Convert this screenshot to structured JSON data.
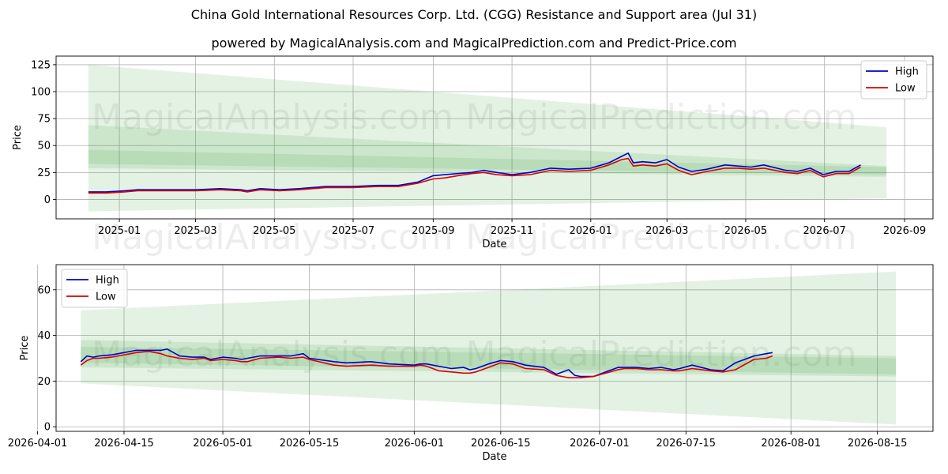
{
  "title": "China Gold International Resources Corp. Ltd. (CGG) Resistance and Support area (Jul 31)",
  "subtitle": "powered by MagicalAnalysis.com and MagicalPrediction.com and Predict-Price.com",
  "watermarks": [
    "MagicalAnalysis.com",
    "MagicalPrediction.com"
  ],
  "colors": {
    "high": "#0000cc",
    "low": "#dd0000",
    "band": "#2e9a2e"
  },
  "chart_data": [
    {
      "type": "line",
      "xlabel": "Date",
      "ylabel": "Price",
      "xlim": [
        "2024-11-13",
        "2026-09-23"
      ],
      "ylim": [
        -18,
        133
      ],
      "x_ticks": [
        "2025-01",
        "2025-03",
        "2025-05",
        "2025-07",
        "2025-09",
        "2025-11",
        "2026-01",
        "2026-03",
        "2026-05",
        "2026-07",
        "2026-09"
      ],
      "y_ticks": [
        0,
        25,
        50,
        75,
        100,
        125
      ],
      "grid": true,
      "legend": "top-right",
      "bands": [
        {
          "x": [
            "2024-12-08",
            "2026-08-18"
          ],
          "upper": [
            125,
            67
          ],
          "lower": [
            -11,
            1
          ]
        },
        {
          "x": [
            "2024-12-08",
            "2026-08-18"
          ],
          "upper": [
            69,
            31
          ],
          "lower": [
            29,
            21
          ]
        },
        {
          "x": [
            "2024-12-08",
            "2026-08-18"
          ],
          "upper": [
            46,
            30
          ],
          "lower": [
            33,
            23
          ]
        }
      ],
      "series": [
        {
          "name": "High",
          "x": [
            "2024-12-08",
            "2024-12-22",
            "2025-01-05",
            "2025-01-15",
            "2025-02-01",
            "2025-02-15",
            "2025-03-01",
            "2025-03-20",
            "2025-04-05",
            "2025-04-10",
            "2025-04-20",
            "2025-05-05",
            "2025-05-20",
            "2025-06-10",
            "2025-07-01",
            "2025-07-20",
            "2025-08-05",
            "2025-08-20",
            "2025-09-01",
            "2025-09-10",
            "2025-09-20",
            "2025-10-01",
            "2025-10-10",
            "2025-10-20",
            "2025-11-01",
            "2025-11-15",
            "2025-12-01",
            "2025-12-15",
            "2026-01-01",
            "2026-01-15",
            "2026-01-25",
            "2026-01-30",
            "2026-02-03",
            "2026-02-10",
            "2026-02-20",
            "2026-03-01",
            "2026-03-10",
            "2026-03-20",
            "2026-04-01",
            "2026-04-15",
            "2026-04-25",
            "2026-05-05",
            "2026-05-15",
            "2026-06-01",
            "2026-06-10",
            "2026-06-20",
            "2026-06-30",
            "2026-07-10",
            "2026-07-20",
            "2026-07-29"
          ],
          "values": [
            7,
            7,
            8,
            9,
            9,
            9,
            9,
            10,
            9,
            8,
            10,
            9,
            10,
            12,
            12,
            13,
            13,
            16,
            22,
            23,
            24,
            25,
            27,
            25,
            23,
            25,
            29,
            28,
            29,
            34,
            40,
            43,
            34,
            35,
            34,
            37,
            30,
            26,
            28,
            32,
            31,
            30,
            32,
            27,
            26,
            29,
            23,
            26,
            26,
            32
          ]
        },
        {
          "name": "Low",
          "x": [
            "2024-12-08",
            "2024-12-22",
            "2025-01-05",
            "2025-01-15",
            "2025-02-01",
            "2025-02-15",
            "2025-03-01",
            "2025-03-20",
            "2025-04-05",
            "2025-04-10",
            "2025-04-20",
            "2025-05-05",
            "2025-05-20",
            "2025-06-10",
            "2025-07-01",
            "2025-07-20",
            "2025-08-05",
            "2025-08-20",
            "2025-09-01",
            "2025-09-10",
            "2025-09-20",
            "2025-10-01",
            "2025-10-10",
            "2025-10-20",
            "2025-11-01",
            "2025-11-15",
            "2025-12-01",
            "2025-12-15",
            "2026-01-01",
            "2026-01-15",
            "2026-01-25",
            "2026-01-30",
            "2026-02-03",
            "2026-02-10",
            "2026-02-20",
            "2026-03-01",
            "2026-03-10",
            "2026-03-20",
            "2026-04-01",
            "2026-04-15",
            "2026-04-25",
            "2026-05-05",
            "2026-05-15",
            "2026-06-01",
            "2026-06-10",
            "2026-06-20",
            "2026-06-30",
            "2026-07-10",
            "2026-07-20",
            "2026-07-29"
          ],
          "values": [
            6,
            6,
            7,
            8,
            8,
            8,
            8,
            9,
            8,
            7,
            9,
            8,
            9,
            11,
            11,
            12,
            12,
            15,
            19,
            20,
            22,
            24,
            25,
            23,
            22,
            23,
            27,
            26,
            27,
            32,
            37,
            38,
            31,
            32,
            31,
            33,
            27,
            23,
            26,
            29,
            29,
            28,
            29,
            25,
            24,
            27,
            21,
            24,
            24,
            30
          ]
        }
      ]
    },
    {
      "type": "line",
      "xlabel": "Date",
      "ylabel": "Price",
      "xlim": [
        "2026-04-04",
        "2026-08-24"
      ],
      "ylim": [
        -2,
        71
      ],
      "x_ticks": [
        "2026-04-01",
        "2026-04-15",
        "2026-05-01",
        "2026-05-15",
        "2026-06-01",
        "2026-06-15",
        "2026-07-01",
        "2026-07-15",
        "2026-08-01",
        "2026-08-15"
      ],
      "y_ticks": [
        0,
        20,
        40,
        60
      ],
      "grid": true,
      "legend": "top-left",
      "bands": [
        {
          "x": [
            "2026-04-08",
            "2026-08-18"
          ],
          "upper": [
            51,
            68
          ],
          "lower": [
            19,
            1
          ]
        },
        {
          "x": [
            "2026-04-08",
            "2026-08-18"
          ],
          "upper": [
            38,
            31
          ],
          "lower": [
            26,
            22
          ]
        },
        {
          "x": [
            "2026-04-08",
            "2026-08-18"
          ],
          "upper": [
            35,
            30
          ],
          "lower": [
            28,
            23
          ]
        }
      ],
      "series": [
        {
          "name": "High",
          "x": [
            "2026-04-08",
            "2026-04-09",
            "2026-04-10",
            "2026-04-11",
            "2026-04-13",
            "2026-04-15",
            "2026-04-17",
            "2026-04-19",
            "2026-04-21",
            "2026-04-22",
            "2026-04-24",
            "2026-04-26",
            "2026-04-28",
            "2026-04-29",
            "2026-05-01",
            "2026-05-03",
            "2026-05-04",
            "2026-05-05",
            "2026-05-07",
            "2026-05-10",
            "2026-05-12",
            "2026-05-14",
            "2026-05-15",
            "2026-05-19",
            "2026-05-21",
            "2026-05-25",
            "2026-05-28",
            "2026-06-01",
            "2026-06-02",
            "2026-06-03",
            "2026-06-05",
            "2026-06-07",
            "2026-06-09",
            "2026-06-10",
            "2026-06-11",
            "2026-06-13",
            "2026-06-15",
            "2026-06-17",
            "2026-06-19",
            "2026-06-22",
            "2026-06-24",
            "2026-06-26",
            "2026-06-27",
            "2026-06-28",
            "2026-06-30",
            "2026-07-02",
            "2026-07-04",
            "2026-07-05",
            "2026-07-07",
            "2026-07-09",
            "2026-07-11",
            "2026-07-13",
            "2026-07-14",
            "2026-07-16",
            "2026-07-19",
            "2026-07-21",
            "2026-07-23",
            "2026-07-26",
            "2026-07-28",
            "2026-07-29"
          ],
          "values": [
            28.5,
            31,
            30.5,
            31,
            31.5,
            32.5,
            33.5,
            33.5,
            33.5,
            34,
            31,
            30.5,
            30.5,
            29.5,
            30.5,
            30,
            29.5,
            30,
            31,
            31,
            31,
            32,
            30,
            28.5,
            28,
            28.5,
            27.5,
            27,
            27.5,
            27.5,
            26.5,
            25.5,
            26,
            25,
            25.5,
            27.5,
            29,
            28.5,
            27,
            26,
            23,
            25,
            22.5,
            22,
            22,
            24,
            26,
            26,
            26,
            25.5,
            26,
            25,
            25.5,
            27,
            25,
            24.5,
            28,
            31,
            32,
            32.5
          ]
        },
        {
          "name": "Low",
          "x": [
            "2026-04-08",
            "2026-04-09",
            "2026-04-10",
            "2026-04-11",
            "2026-04-13",
            "2026-04-15",
            "2026-04-17",
            "2026-04-19",
            "2026-04-21",
            "2026-04-22",
            "2026-04-24",
            "2026-04-26",
            "2026-04-28",
            "2026-04-29",
            "2026-05-01",
            "2026-05-03",
            "2026-05-04",
            "2026-05-05",
            "2026-05-07",
            "2026-05-10",
            "2026-05-12",
            "2026-05-14",
            "2026-05-15",
            "2026-05-19",
            "2026-05-21",
            "2026-05-25",
            "2026-05-28",
            "2026-06-01",
            "2026-06-02",
            "2026-06-03",
            "2026-06-05",
            "2026-06-07",
            "2026-06-09",
            "2026-06-10",
            "2026-06-11",
            "2026-06-13",
            "2026-06-15",
            "2026-06-17",
            "2026-06-19",
            "2026-06-22",
            "2026-06-24",
            "2026-06-26",
            "2026-06-27",
            "2026-06-28",
            "2026-06-30",
            "2026-07-02",
            "2026-07-04",
            "2026-07-05",
            "2026-07-07",
            "2026-07-09",
            "2026-07-11",
            "2026-07-13",
            "2026-07-14",
            "2026-07-16",
            "2026-07-19",
            "2026-07-21",
            "2026-07-23",
            "2026-07-26",
            "2026-07-28",
            "2026-07-29"
          ],
          "values": [
            27,
            29,
            30,
            30,
            30.5,
            31.5,
            32.5,
            33,
            32,
            31,
            30,
            29.5,
            30,
            29,
            29.5,
            29,
            28.5,
            28.5,
            30,
            30.5,
            30,
            30.5,
            29.5,
            27,
            26.5,
            27,
            26.5,
            26.5,
            27,
            26.5,
            24.5,
            24,
            23.5,
            23.5,
            24,
            26,
            28,
            27.5,
            25.5,
            25,
            22.5,
            21.5,
            21.5,
            21.5,
            22,
            23.5,
            25,
            25.5,
            25.5,
            25,
            25,
            24.5,
            24.5,
            25.5,
            24.5,
            24,
            25,
            29.5,
            30,
            31
          ]
        }
      ]
    }
  ]
}
